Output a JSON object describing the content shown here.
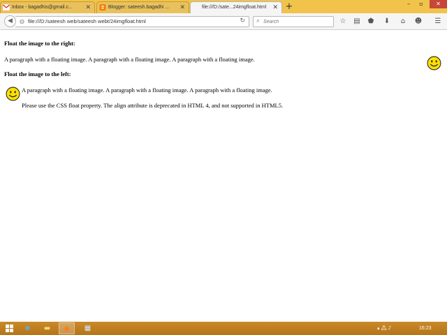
{
  "window": {
    "minimize_icon": "minimize-icon",
    "minimize_glyph": "–",
    "maximize_icon": "maximize-icon",
    "maximize_glyph": "▫",
    "close_icon": "close-icon",
    "close_glyph": "✕"
  },
  "tabs": [
    {
      "label": "Inbox - bagadhis@gmail.c...",
      "icon": "gmail-icon",
      "active": false,
      "close_glyph": "✕"
    },
    {
      "label": "Blogger: sateesh.bagadhi ...",
      "icon": "blogger-icon",
      "active": false,
      "close_glyph": "✕"
    },
    {
      "label": "file:///D:/sate...24imgfloat.html",
      "icon": "page-icon",
      "active": true,
      "close_glyph": "✕"
    }
  ],
  "new_tab_glyph": "+",
  "nav": {
    "back_glyph": "◀",
    "url": "file:///D:/sateesh web/sateesh webt/24imgfloat.html",
    "site_icon_glyph": "◍",
    "reload_glyph": "↻",
    "search_placeholder": "Search",
    "search_icon_glyph": "⌕",
    "toolbar_icons": [
      {
        "name": "bookmark-star-icon",
        "glyph": "☆"
      },
      {
        "name": "reading-list-icon",
        "glyph": "▤"
      },
      {
        "name": "pocket-icon",
        "glyph": "⬟"
      },
      {
        "name": "downloads-icon",
        "glyph": "⬇"
      },
      {
        "name": "home-icon",
        "glyph": "⌂"
      },
      {
        "name": "chat-icon",
        "glyph": "☻"
      },
      {
        "name": "menu-icon",
        "glyph": "☰"
      }
    ]
  },
  "page": {
    "heading_right": "Float the image to the right:",
    "paragraph_right": "A paragraph with a floating image. A paragraph with a floating image. A paragraph with a floating image.",
    "heading_left": "Float the image to the left:",
    "paragraph_left": "A paragraph with a floating image. A paragraph with a floating image. A paragraph with a floating image.",
    "note": "Please use the CSS float property. The align attribute is deprecated in HTML 4, and not supported in HTML5.",
    "image_icon": "smiley-icon"
  },
  "taskbar": {
    "start_icon": "windows-start-icon",
    "apps": [
      {
        "name": "internet-explorer-icon",
        "glyph": "e",
        "active": false
      },
      {
        "name": "file-explorer-icon",
        "glyph": "▬",
        "active": false
      },
      {
        "name": "firefox-icon",
        "glyph": "◉",
        "active": true
      },
      {
        "name": "notepad-icon",
        "glyph": "▦",
        "active": false
      }
    ],
    "tray_glyphs": "▴ 🖧 ♪",
    "clock": "16:23"
  },
  "colors": {
    "titlebar": "#f1c34a",
    "taskbar": "#c0801f",
    "smiley_face": "#ffe000",
    "link_accent": "#c7463a"
  }
}
